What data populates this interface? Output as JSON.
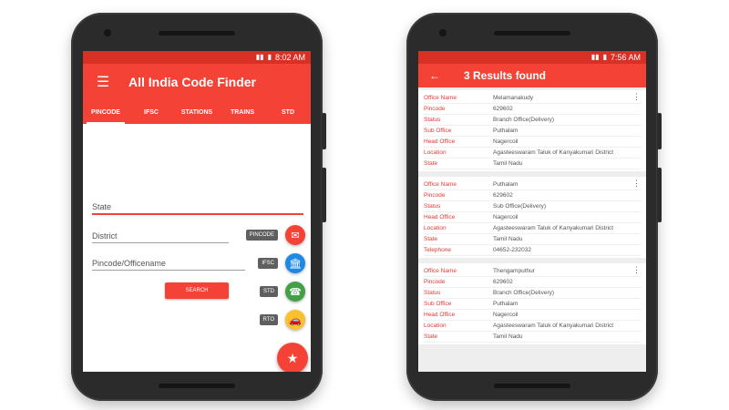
{
  "phone1": {
    "status_time": "8:02 AM",
    "app_title": "All India Code Finder",
    "tabs": [
      {
        "label": "PINCODE",
        "active": true
      },
      {
        "label": "IFSC",
        "active": false
      },
      {
        "label": "STATIONS",
        "active": false
      },
      {
        "label": "TRAINS",
        "active": false
      },
      {
        "label": "STD",
        "active": false
      }
    ],
    "fields": {
      "state": "State",
      "district": "District",
      "pincode": "Pincode/Officename"
    },
    "search_label": "SEARCH",
    "dial": [
      {
        "label": "PINCODE",
        "icon": "envelope-icon",
        "color": "#f44336"
      },
      {
        "label": "IFSC",
        "icon": "bank-icon",
        "color": "#1e88e5"
      },
      {
        "label": "STD",
        "icon": "telephone-icon",
        "color": "#43a047"
      },
      {
        "label": "RTO",
        "icon": "car-icon",
        "color": "#fbc02d"
      }
    ],
    "fab_icon": "star-icon"
  },
  "phone2": {
    "status_time": "7:56 AM",
    "title": "3 Results found",
    "results": [
      {
        "rows": [
          {
            "k": "Office Name",
            "v": "Melamanakudy"
          },
          {
            "k": "Pincode",
            "v": "629602"
          },
          {
            "k": "Status",
            "v": "Branch Office(Delivery)"
          },
          {
            "k": "Sub Office",
            "v": "Puthalam"
          },
          {
            "k": "Head Office",
            "v": "Nagercoil"
          },
          {
            "k": "Location",
            "v": "Agasteeswaram Taluk of Kanyakumari District"
          },
          {
            "k": "State",
            "v": "Tamil Nadu"
          }
        ]
      },
      {
        "rows": [
          {
            "k": "Office Name",
            "v": "Puthalam"
          },
          {
            "k": "Pincode",
            "v": "629602"
          },
          {
            "k": "Status",
            "v": "Sub Office(Delivery)"
          },
          {
            "k": "Head Office",
            "v": "Nagercoil"
          },
          {
            "k": "Location",
            "v": "Agasteeswaram Taluk of Kanyakumari District"
          },
          {
            "k": "State",
            "v": "Tamil Nadu"
          },
          {
            "k": "Telephone",
            "v": "04652-232032"
          }
        ]
      },
      {
        "rows": [
          {
            "k": "Office Name",
            "v": "Thengamputhur"
          },
          {
            "k": "Pincode",
            "v": "629602"
          },
          {
            "k": "Status",
            "v": "Branch Office(Delivery)"
          },
          {
            "k": "Sub Office",
            "v": "Puthalam"
          },
          {
            "k": "Head Office",
            "v": "Nagercoil"
          },
          {
            "k": "Location",
            "v": "Agasteeswaram Taluk of Kanyakumari District"
          },
          {
            "k": "State",
            "v": "Tamil Nadu"
          }
        ]
      }
    ]
  }
}
